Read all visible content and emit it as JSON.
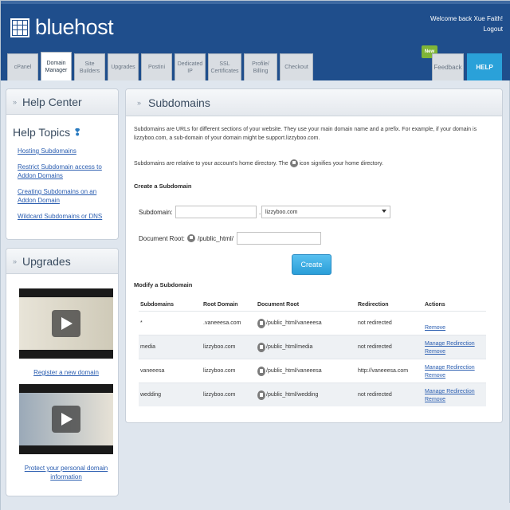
{
  "header": {
    "logo_text": "bluehost",
    "welcome_text": "Welcome back Xue Faith!",
    "logout_label": "Logout",
    "tabs": [
      {
        "label": "cPanel",
        "active": false
      },
      {
        "label": "Domain Manager",
        "active": true
      },
      {
        "label": "Site Builders",
        "active": false
      },
      {
        "label": "Upgrades",
        "active": false
      },
      {
        "label": "Postini",
        "active": false
      },
      {
        "label": "Dedicated IP",
        "active": false
      },
      {
        "label": "SSL Certificates",
        "active": false
      },
      {
        "label": "Profile/ Billing",
        "active": false
      },
      {
        "label": "Checkout",
        "active": false
      }
    ],
    "new_badge": "New",
    "feedback_label": "Feedback",
    "help_label": "HELP"
  },
  "sidebar": {
    "help_center": {
      "title": "Help Center",
      "topics_title": "Help Topics",
      "links": [
        "Hosting Subdomains",
        "Restrict Subdomain access to Addon Domains",
        "Creating Subdomains on an Addon Domain",
        "Wildcard Subdomains or DNS"
      ]
    },
    "upgrades": {
      "title": "Upgrades",
      "videos": [
        {
          "link": "Register a new domain"
        },
        {
          "link": "Protect your personal domain information"
        }
      ]
    }
  },
  "main": {
    "title": "Subdomains",
    "description_1": "Subdomains are URLs for different sections of your website. They use your main domain name and a prefix. For example, if your domain is lizzyboo.com, a sub-domain of your domain might be support.lizzyboo.com.",
    "description_2a": "Subdomains are relative to your account's home directory. The",
    "description_2b": "icon signifies your home directory.",
    "create_section": "Create a Subdomain",
    "subdomain_label": "Subdomain:",
    "subdomain_value": "",
    "dot_separator": ".",
    "domain_select": "lizzyboo.com",
    "document_root_label": "Document Root:",
    "document_root_prefix": "/public_html/",
    "document_root_value": "",
    "create_button": "Create",
    "modify_section": "Modify a Subdomain",
    "table": {
      "headers": [
        "Subdomains",
        "Root Domain",
        "Document Root",
        "Redirection",
        "Actions"
      ],
      "rows": [
        {
          "subdomain": "*",
          "root": ".vaneeesa.com",
          "docroot": "/public_html/vaneeesa",
          "redirection": "not redirected",
          "manage": "",
          "remove": "Remove"
        },
        {
          "subdomain": "media",
          "root": "lizzyboo.com",
          "docroot": "/public_html/media",
          "redirection": "not redirected",
          "manage": "Manage Redirection",
          "remove": "Remove"
        },
        {
          "subdomain": "vaneeesa",
          "root": "lizzyboo.com",
          "docroot": "/public_html/vaneeesa",
          "redirection": "http://vaneeesa.com",
          "manage": "Manage Redirection",
          "remove": "Remove"
        },
        {
          "subdomain": "wedding",
          "root": "lizzyboo.com",
          "docroot": "/public_html/wedding",
          "redirection": "not redirected",
          "manage": "Manage Redirection",
          "remove": "Remove"
        }
      ]
    }
  }
}
